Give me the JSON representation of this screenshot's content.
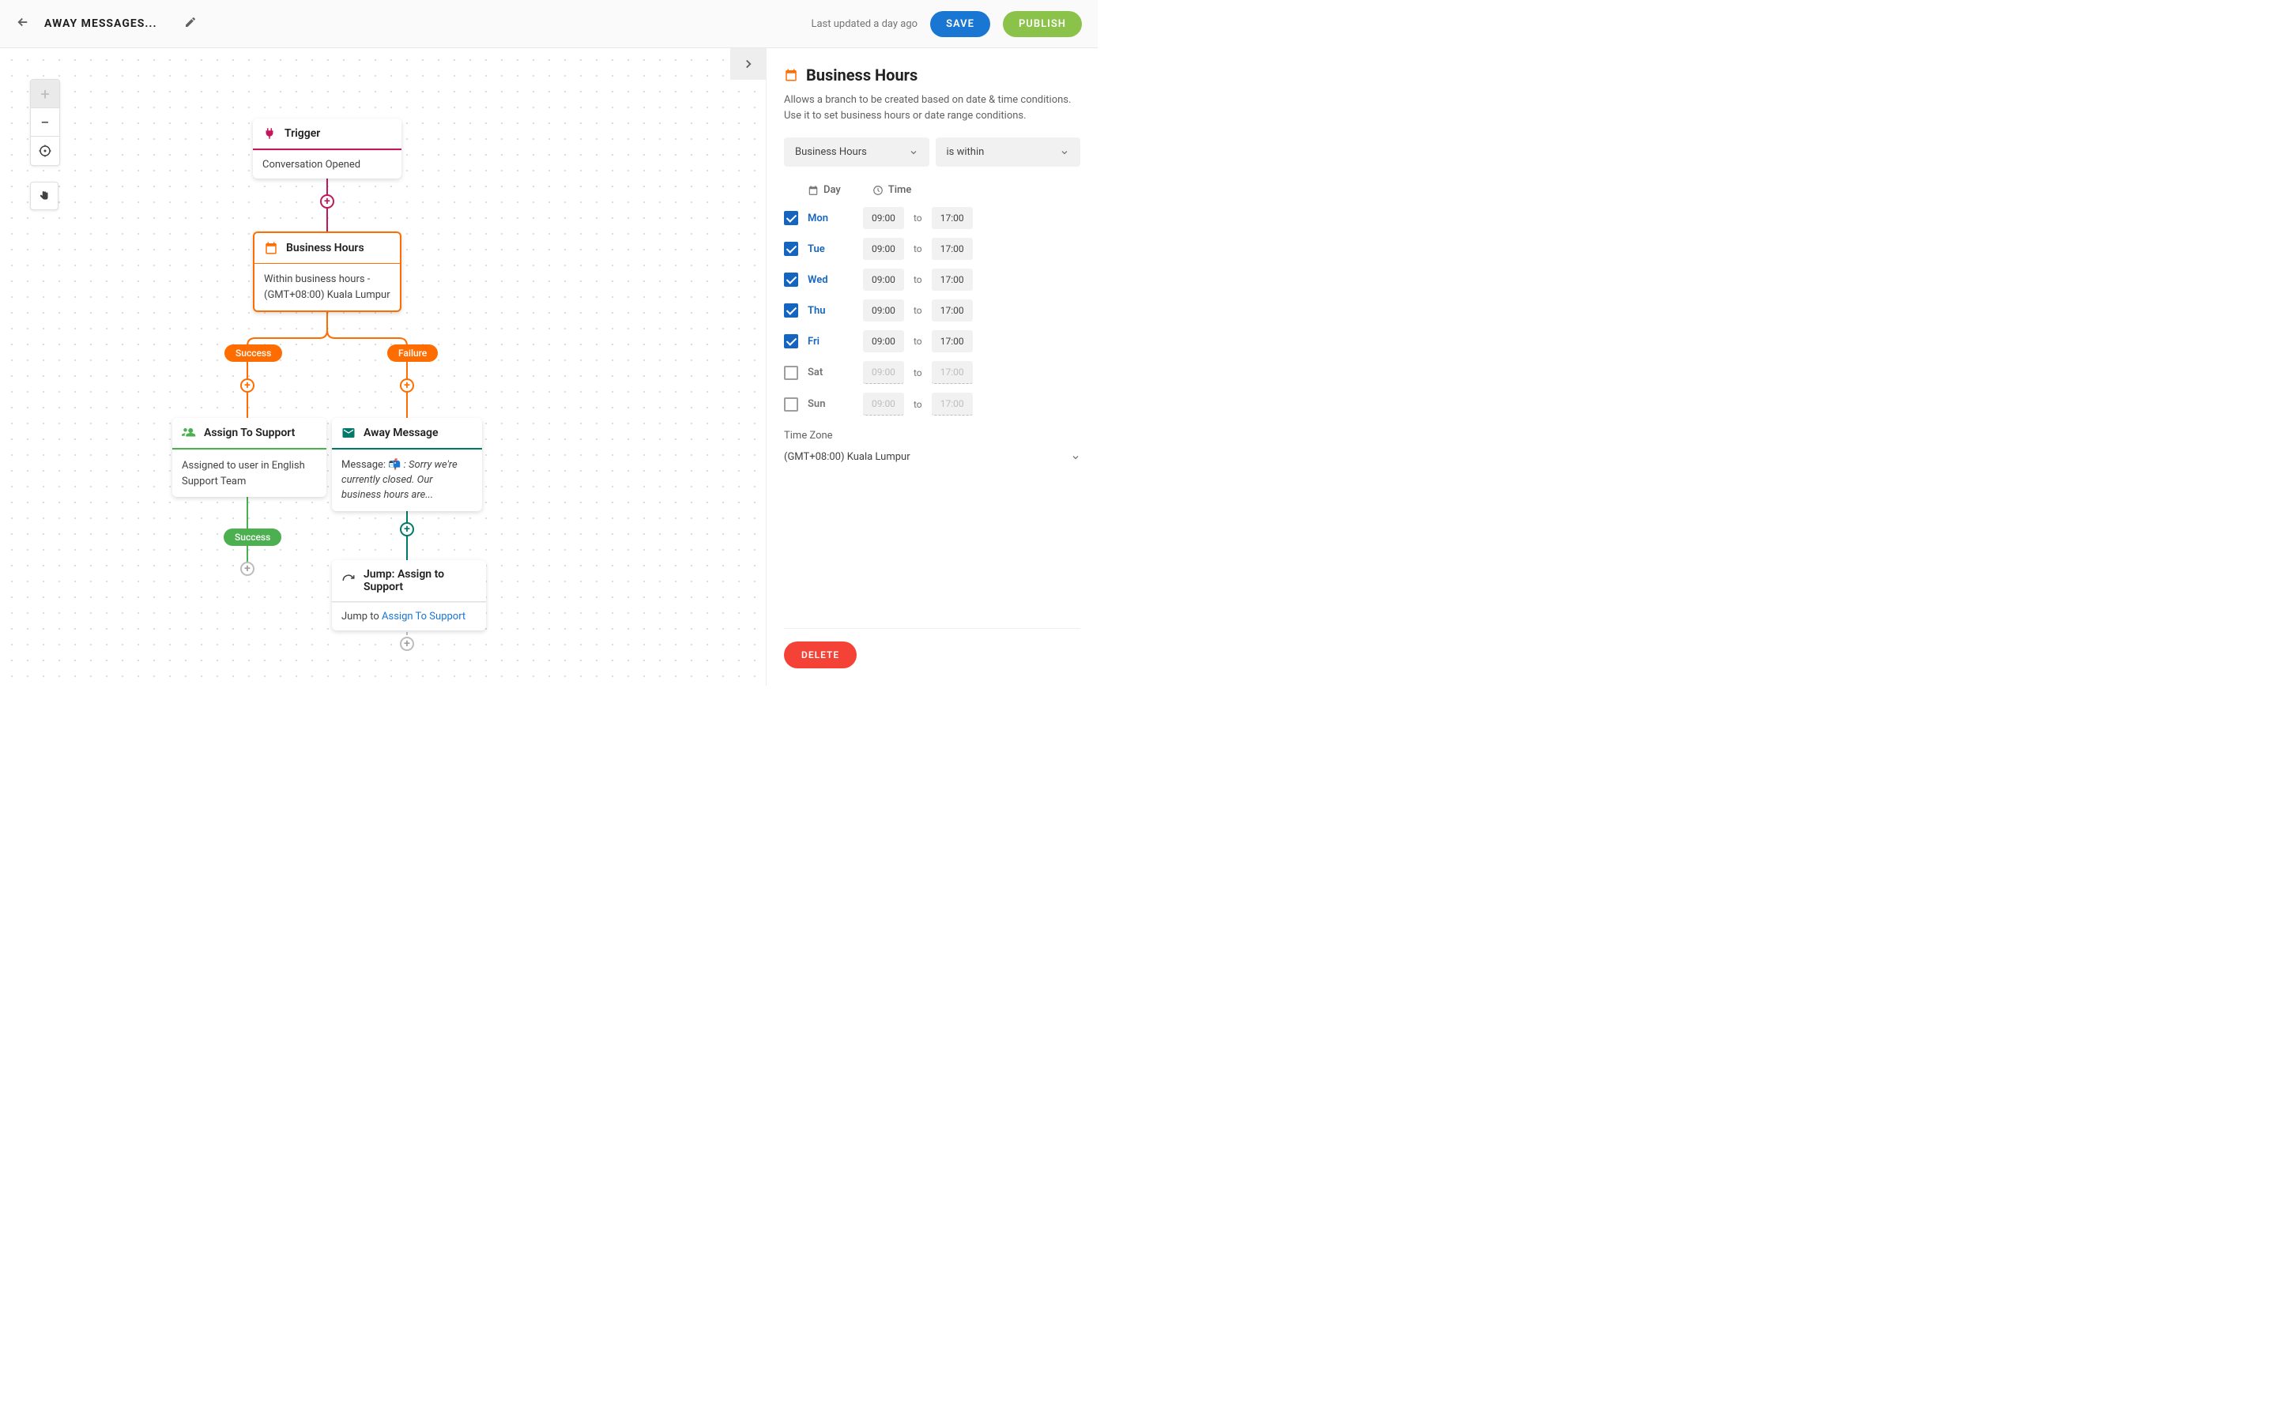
{
  "header": {
    "title": "AWAY MESSAGES...",
    "last_updated": "Last updated a day ago",
    "save_label": "SAVE",
    "publish_label": "PUBLISH"
  },
  "flow": {
    "trigger": {
      "title": "Trigger",
      "body": "Conversation Opened"
    },
    "business_hours": {
      "title": "Business Hours",
      "body": "Within business hours - (GMT+08:00) Kuala Lumpur"
    },
    "branches": {
      "success": "Success",
      "failure": "Failure"
    },
    "assign": {
      "title": "Assign To Support",
      "body": "Assigned to user in English Support Team"
    },
    "away": {
      "title": "Away Message",
      "prefix": "Message: 📬 ",
      "body": ": Sorry we're currently closed. Our business hours are..."
    },
    "jump": {
      "title": "Jump: Assign to Support",
      "prefix": "Jump to ",
      "link": "Assign To Support"
    },
    "end_success": "Success"
  },
  "panel": {
    "title": "Business Hours",
    "description": "Allows a branch to be created based on date & time conditions. Use it to set business hours or date range conditions.",
    "type_select": "Business Hours",
    "condition_select": "is within",
    "headers": {
      "day": "Day",
      "time": "Time"
    },
    "days": [
      {
        "label": "Mon",
        "checked": true,
        "start": "09:00",
        "end": "17:00"
      },
      {
        "label": "Tue",
        "checked": true,
        "start": "09:00",
        "end": "17:00"
      },
      {
        "label": "Wed",
        "checked": true,
        "start": "09:00",
        "end": "17:00"
      },
      {
        "label": "Thu",
        "checked": true,
        "start": "09:00",
        "end": "17:00"
      },
      {
        "label": "Fri",
        "checked": true,
        "start": "09:00",
        "end": "17:00"
      },
      {
        "label": "Sat",
        "checked": false,
        "start": "09:00",
        "end": "17:00"
      },
      {
        "label": "Sun",
        "checked": false,
        "start": "09:00",
        "end": "17:00"
      }
    ],
    "to_label": "to",
    "timezone_label": "Time Zone",
    "timezone_value": "(GMT+08:00) Kuala Lumpur",
    "delete_label": "DELETE"
  }
}
